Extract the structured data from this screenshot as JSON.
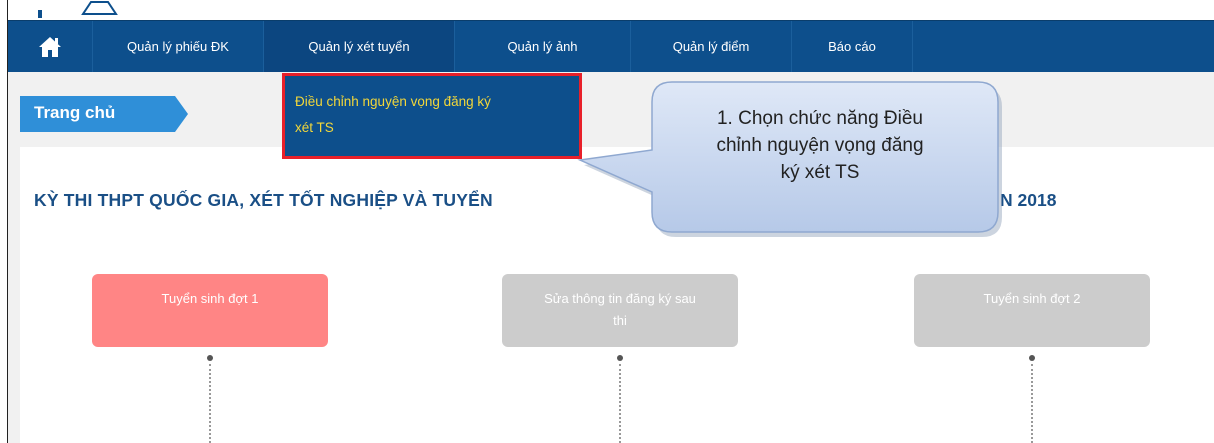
{
  "navbar": {
    "items": [
      {
        "label": "Quản lý phiếu ĐK"
      },
      {
        "label": "Quản lý xét tuyển"
      },
      {
        "label": "Quản lý ảnh"
      },
      {
        "label": "Quản lý điểm"
      },
      {
        "label": "Báo cáo"
      }
    ]
  },
  "dropdown": {
    "items": [
      {
        "label": "Điều chỉnh nguyện vọng đăng ký"
      },
      {
        "label": "xét TS"
      }
    ]
  },
  "breadcrumb": {
    "label": "Trang chủ"
  },
  "page": {
    "title": "KỲ THI THPT QUỐC GIA, XÉT TỐT NGHIỆP VÀ TUYỂN",
    "title_tail": "N 2018"
  },
  "callout": {
    "lines": [
      "1. Chọn chức năng Điều",
      "chỉnh nguyện vọng đăng",
      "ký xét TS"
    ]
  },
  "steps": [
    {
      "label": "Tuyển sinh đợt 1"
    },
    {
      "line1": "Sửa thông tin đăng ký sau",
      "line2": "thi"
    },
    {
      "label": "Tuyển sinh đợt 2"
    }
  ],
  "colors": {
    "nav_bg": "#0d4f8c",
    "dropdown_text": "#f2d73a",
    "highlight_border": "#e8202a",
    "breadcrumb_bg": "#2f8fd8",
    "step_active": "#ff8585",
    "step_inactive": "#cccccc",
    "title": "#1a4f86"
  }
}
